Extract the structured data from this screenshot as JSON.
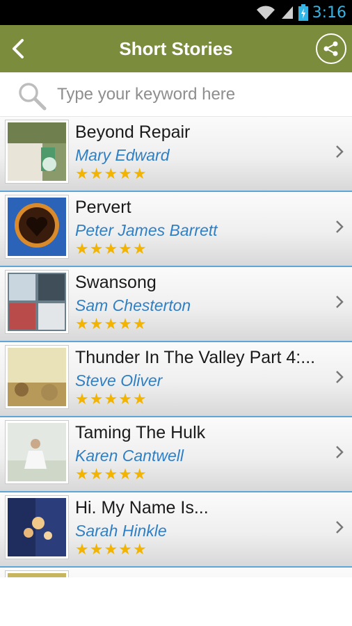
{
  "status_bar": {
    "time": "3:16",
    "icons": [
      "wifi-icon",
      "signal-icon",
      "battery-charging-icon"
    ]
  },
  "header": {
    "title": "Short Stories",
    "back_icon": "chevron-left-icon",
    "share_icon": "share-icon",
    "background": "#7b8c3c"
  },
  "search": {
    "placeholder": "Type your keyword here",
    "value": ""
  },
  "stories": [
    {
      "title": "Beyond Repair",
      "author": "Mary Edward",
      "rating": 5,
      "stars": "★★★★★"
    },
    {
      "title": "Pervert",
      "author": "Peter James Barrett",
      "rating": 5,
      "stars": "★★★★★"
    },
    {
      "title": "Swansong",
      "author": "Sam Chesterton",
      "rating": 5,
      "stars": "★★★★★"
    },
    {
      "title": "Thunder In The Valley Part 4:...",
      "author": "Steve Oliver",
      "rating": 5,
      "stars": "★★★★★"
    },
    {
      "title": "Taming The Hulk",
      "author": "Karen Cantwell",
      "rating": 5,
      "stars": "★★★★★"
    },
    {
      "title": "Hi. My Name Is...",
      "author": "Sarah Hinkle",
      "rating": 5,
      "stars": "★★★★★"
    }
  ],
  "colors": {
    "accent": "#7b8c3c",
    "author": "#2f7fc5",
    "star": "#f2b400",
    "divider": "#5ea6d8",
    "time": "#33b5e5"
  }
}
